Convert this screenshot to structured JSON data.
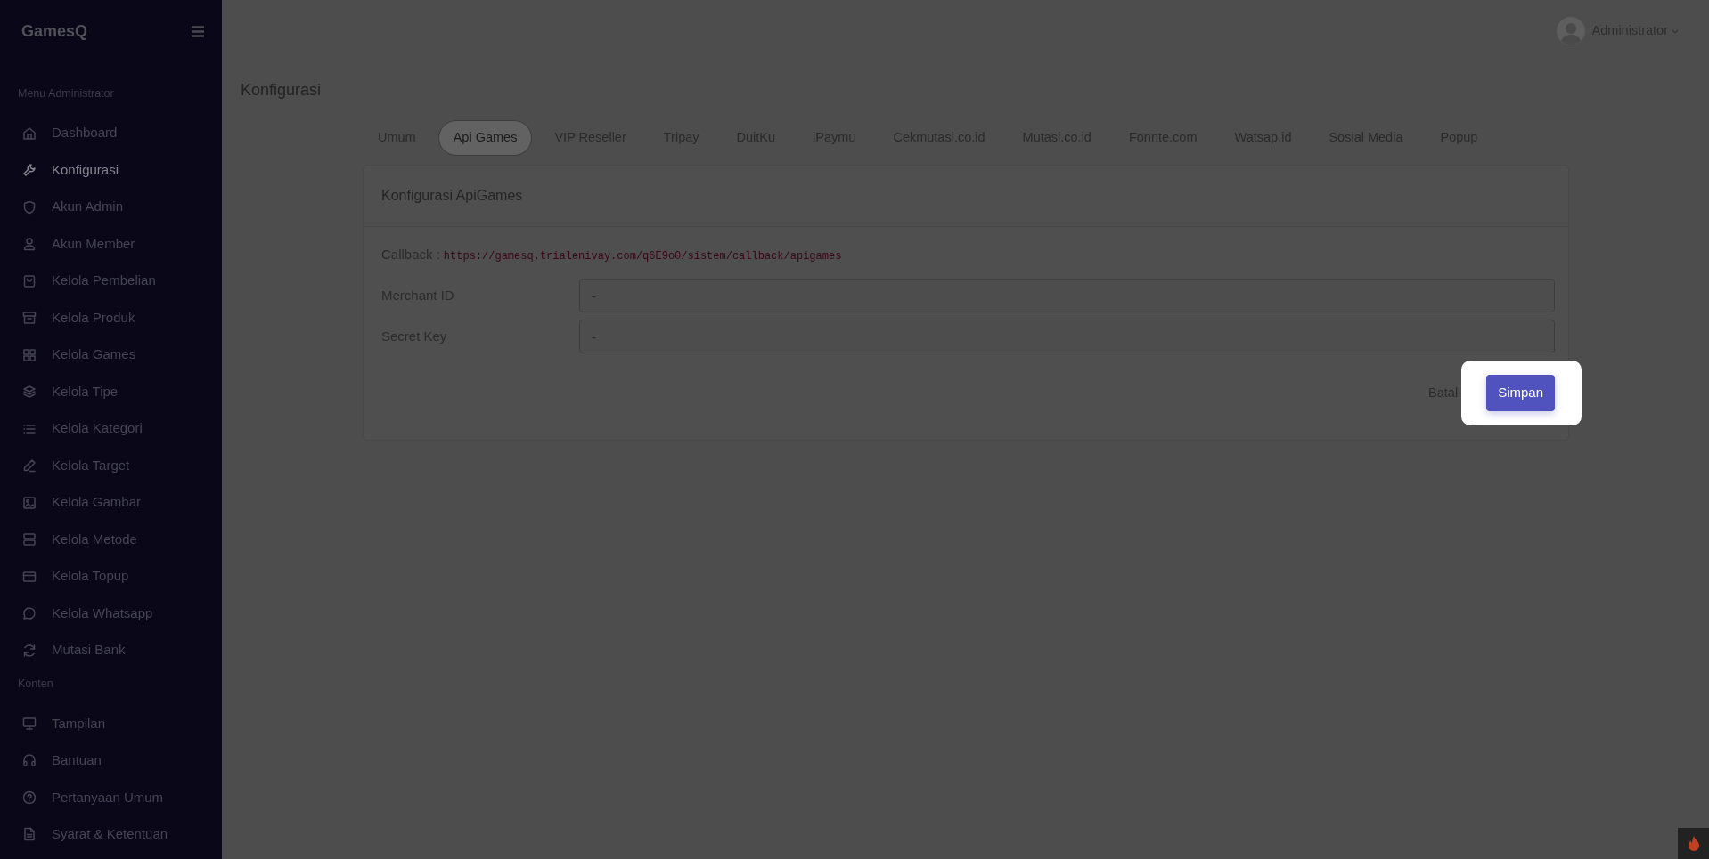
{
  "brand": "GamesQ",
  "sidebar": {
    "sections": [
      {
        "label": "Menu Administrator",
        "items": [
          {
            "label": "Dashboard",
            "selected": false
          },
          {
            "label": "Konfigurasi",
            "selected": true
          },
          {
            "label": "Akun Admin",
            "selected": false
          },
          {
            "label": "Akun Member",
            "selected": false
          },
          {
            "label": "Kelola Pembelian",
            "selected": false
          },
          {
            "label": "Kelola Produk",
            "selected": false
          },
          {
            "label": "Kelola Games",
            "selected": false
          },
          {
            "label": "Kelola Tipe",
            "selected": false
          },
          {
            "label": "Kelola Kategori",
            "selected": false
          },
          {
            "label": "Kelola Target",
            "selected": false
          },
          {
            "label": "Kelola Gambar",
            "selected": false
          },
          {
            "label": "Kelola Metode",
            "selected": false
          },
          {
            "label": "Kelola Topup",
            "selected": false
          },
          {
            "label": "Kelola Whatsapp",
            "selected": false
          },
          {
            "label": "Mutasi Bank",
            "selected": false
          }
        ]
      },
      {
        "label": "Konten",
        "items": [
          {
            "label": "Tampilan",
            "selected": false
          },
          {
            "label": "Bantuan",
            "selected": false
          },
          {
            "label": "Pertanyaan Umum",
            "selected": false
          },
          {
            "label": "Syarat & Ketentuan",
            "selected": false
          }
        ]
      }
    ]
  },
  "user": {
    "name": "Administrator"
  },
  "page_title": "Konfigurasi",
  "tabs": [
    {
      "label": "Umum",
      "selected": false
    },
    {
      "label": "Api Games",
      "selected": true
    },
    {
      "label": "VIP Reseller",
      "selected": false
    },
    {
      "label": "Tripay",
      "selected": false
    },
    {
      "label": "DuitKu",
      "selected": false
    },
    {
      "label": "iPaymu",
      "selected": false
    },
    {
      "label": "Cekmutasi.co.id",
      "selected": false
    },
    {
      "label": "Mutasi.co.id",
      "selected": false
    },
    {
      "label": "Fonnte.com",
      "selected": false
    },
    {
      "label": "Watsap.id",
      "selected": false
    },
    {
      "label": "Sosial Media",
      "selected": false
    },
    {
      "label": "Popup",
      "selected": false
    }
  ],
  "card": {
    "title": "Konfigurasi ApiGames",
    "callback": {
      "label": "Callback :",
      "url": "https://gamesq.trialenivay.com/q6E9o0/sistem/callback/apigames"
    },
    "fields": [
      {
        "label": "Merchant ID",
        "value": "-"
      },
      {
        "label": "Secret Key",
        "value": "-"
      }
    ],
    "cancel_button": "Batal",
    "save_button": {
      "label": "Simpan",
      "highlighted": true
    }
  }
}
